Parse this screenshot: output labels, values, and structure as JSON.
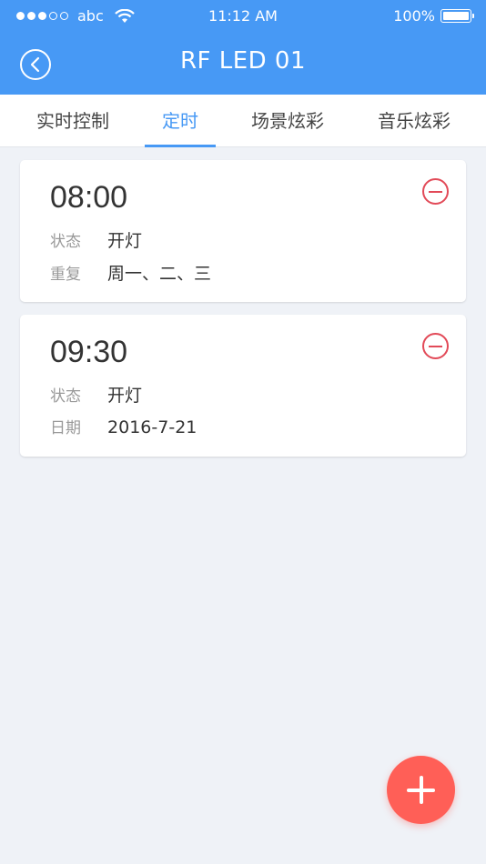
{
  "status_bar": {
    "carrier": "abc",
    "time": "11:12 AM",
    "battery": "100%"
  },
  "header": {
    "title": "RF LED 01",
    "back_icon": "chevron-left-icon"
  },
  "tabs": [
    {
      "label": "实时控制",
      "active": false
    },
    {
      "label": "定时",
      "active": true
    },
    {
      "label": "场景炫彩",
      "active": false
    },
    {
      "label": "音乐炫彩",
      "active": false
    }
  ],
  "timers": [
    {
      "time": "08:00",
      "status_label": "状态",
      "status_value": "开灯",
      "second_label": "重复",
      "second_value": "周一、二、三"
    },
    {
      "time": "09:30",
      "status_label": "状态",
      "status_value": "开灯",
      "second_label": "日期",
      "second_value": "2016-7-21"
    }
  ],
  "colors": {
    "accent": "#4799f5",
    "remove": "#e24a58",
    "fab": "#ff5f57"
  },
  "icons": {
    "remove": "minus-circle-icon",
    "add": "plus-icon",
    "wifi": "wifi-icon",
    "battery": "battery-icon"
  }
}
